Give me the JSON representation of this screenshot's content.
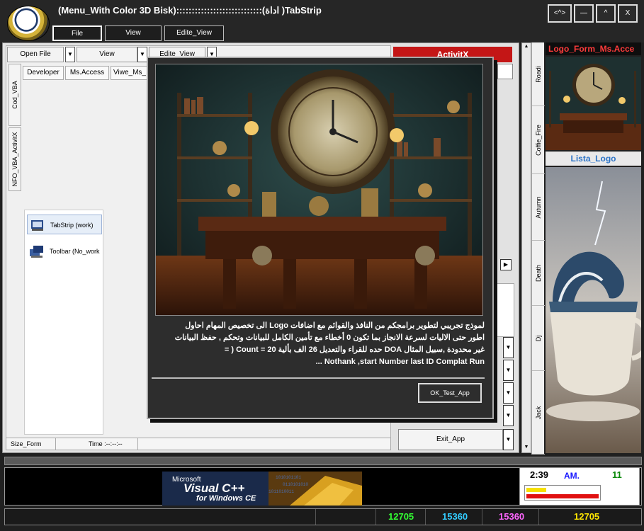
{
  "window": {
    "title": "(Menu_With Color 3D Bisk)::::::::::::::::::::::::::::(اداة )TabStrip",
    "controls": [
      "<^>",
      "—",
      "^",
      "X"
    ]
  },
  "menu_tabs": [
    "File",
    "View",
    "Edite_View"
  ],
  "toolbar": {
    "open_file": "Open File",
    "view": "View",
    "edite_view": "Edite_View"
  },
  "tabs": [
    "Developer",
    "Ms.Access",
    "Viwe_Ms_"
  ],
  "left_vtabs": [
    "Cod_VBA",
    "NFO_VBA_ActivitX"
  ],
  "tree_items": [
    "TabStrip (work)",
    "Toolbar (No_work"
  ],
  "status": {
    "size_form": "Size_Form",
    "time": "Time :--:--:--"
  },
  "activitx_label": "ActivitX",
  "exit_label": "Exit_App",
  "dialog": {
    "text_lines": [
      "لموذج تجريبي لتطوير برامجكم من النافذ والقوائم مع اضافات Logo الى تخصيص المهام احاول",
      "اطور حتى الاليات لسرعة الانجاز بما تكون 0 أخطاء مع تأمين الكامل للبيانات وتحكم , حفظ البيانات",
      "غير محدودة ,سبيل المثال DOA حده للقراء والتعديل 26 الف بألية 20 = Count ( =",
      "Nothank ,start Number last ID Complat Run ..."
    ],
    "ok_label": "OK_Test_App"
  },
  "right_tabs": [
    "Roadi",
    "Coffie_Fire",
    "Autumn",
    "Death",
    "Dj",
    "Jack"
  ],
  "logo_form_label": "Logo_Form_Ms.Acce",
  "lista_logo_label": "Lista_Logo",
  "banner": {
    "line1": "Microsoft",
    "line2": "Visual C++",
    "line3": "for Windows CE"
  },
  "clock": {
    "time": "2:39",
    "ampm": "AM.",
    "seconds": "11"
  },
  "bottom_numbers": [
    {
      "value": "12705",
      "color": "#33ff33"
    },
    {
      "value": "15360",
      "color": "#33ccff"
    },
    {
      "value": "15360",
      "color": "#ff66ff"
    },
    {
      "value": "12705",
      "color": "#ffe600"
    }
  ],
  "colors": {
    "accent_red": "#c41616",
    "lista_blue": "#2c74c7"
  }
}
